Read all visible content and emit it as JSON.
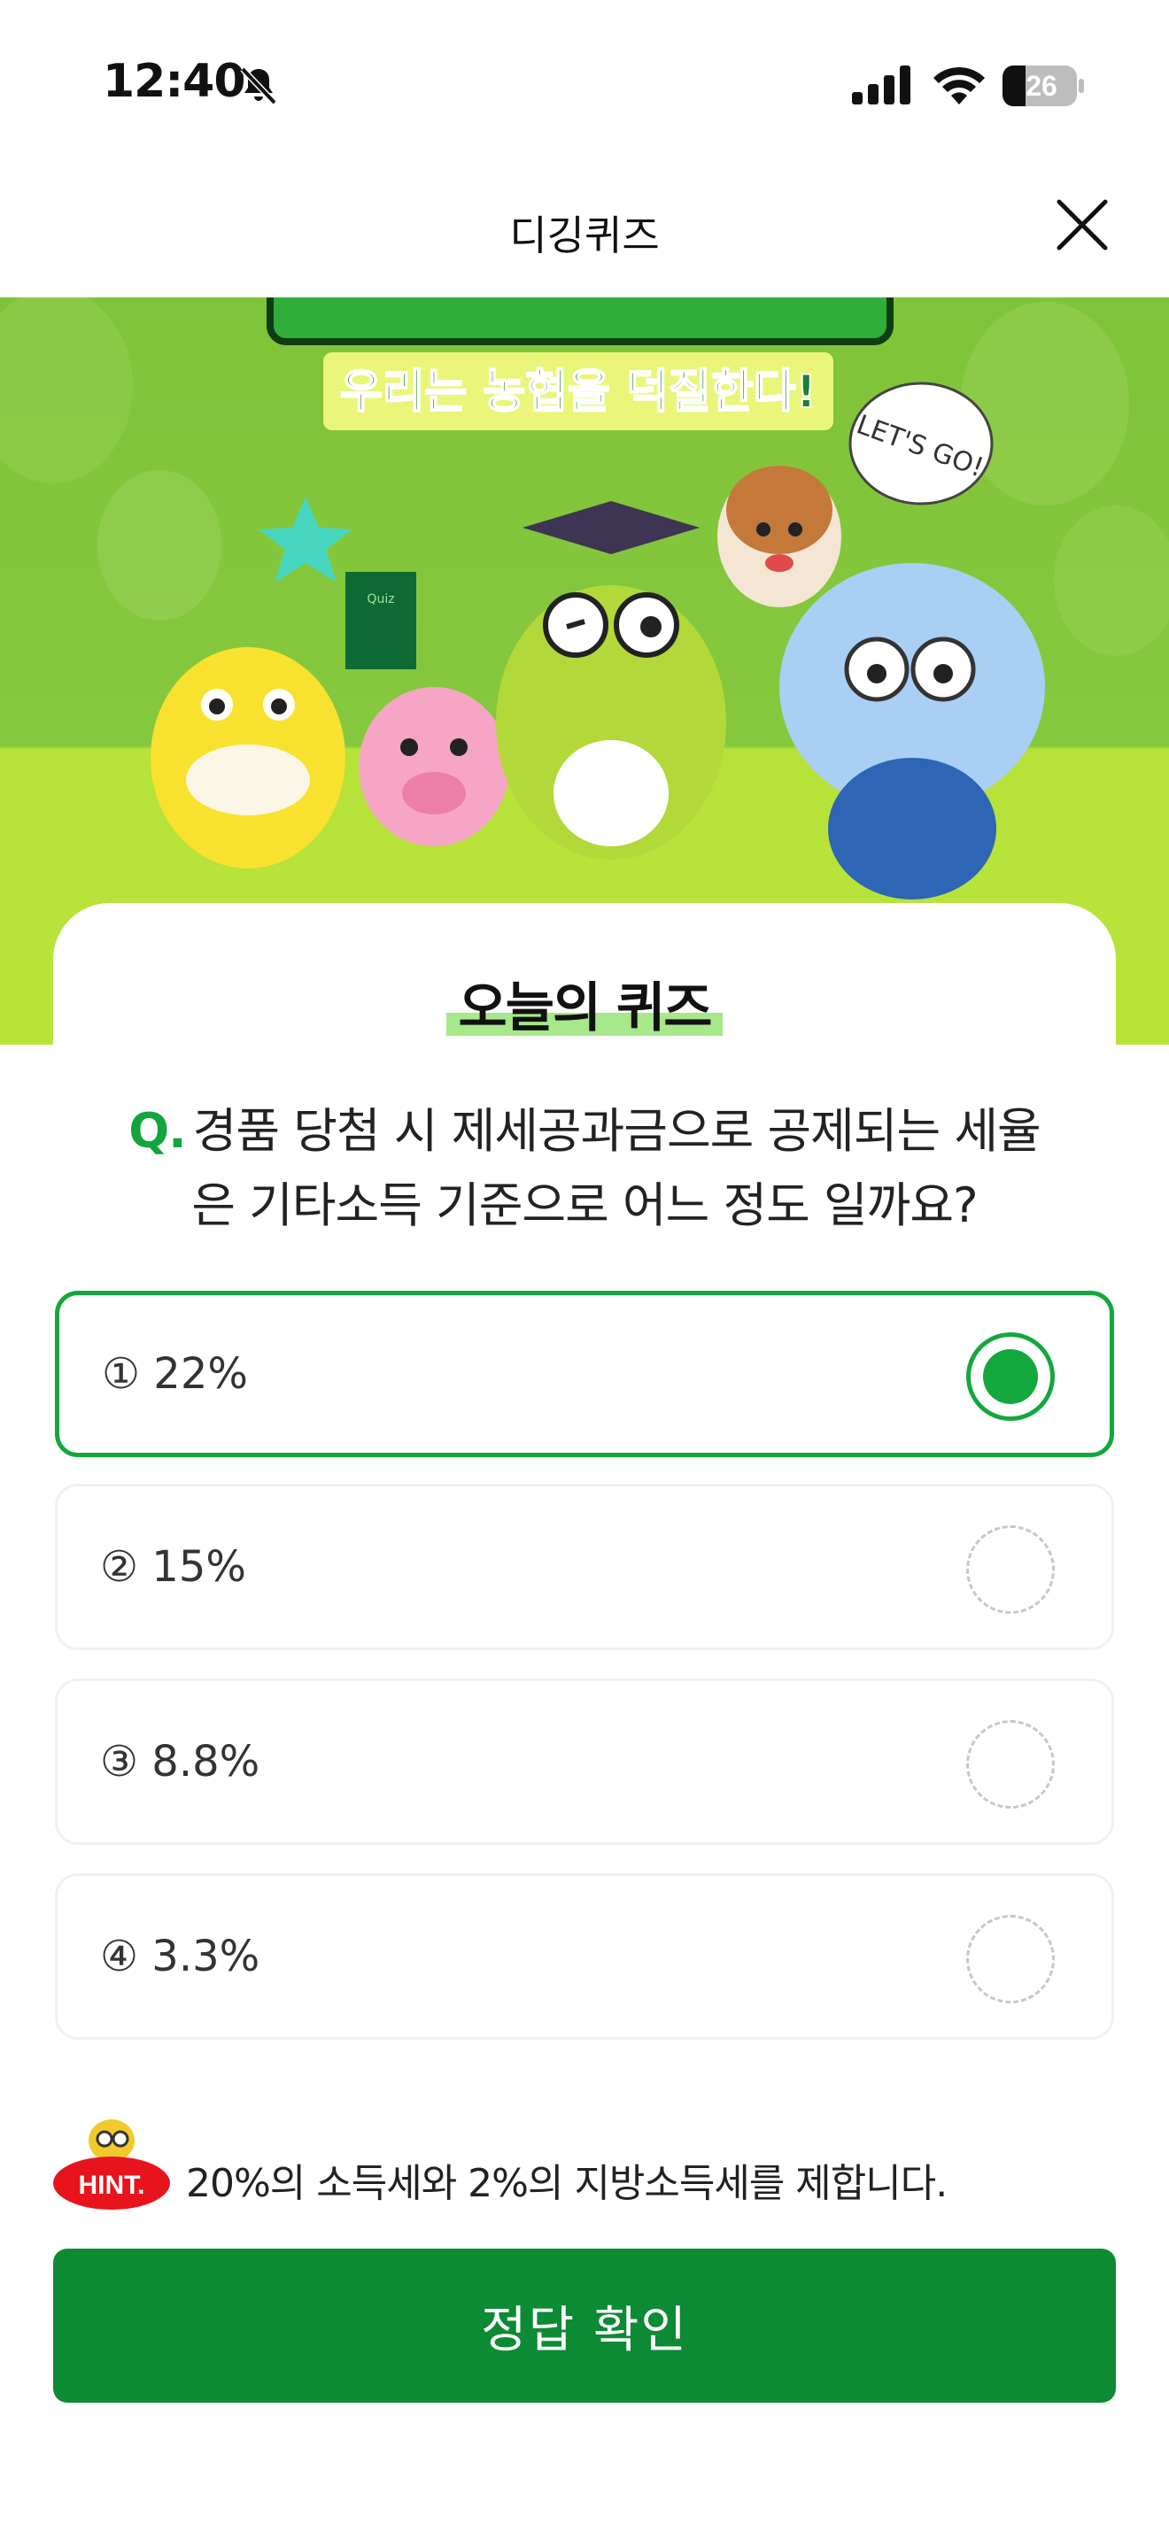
{
  "status_bar": {
    "time": "12:40",
    "battery": "26"
  },
  "header": {
    "title": "디깅퀴즈"
  },
  "banner": {
    "slogan": "우리는 농협을 덕질한다!",
    "bubble": "LET'S GO!",
    "book_label": "Quiz"
  },
  "quiz": {
    "title": "오늘의 퀴즈",
    "question_mark": "Q.",
    "question_line1": "경품 당첨 시 제세공과금으로 공제되는 세율",
    "question_line2": "은 기타소득 기준으로 어느 정도 일까요?",
    "options": [
      {
        "label": "① 22%",
        "selected": true
      },
      {
        "label": "② 15%",
        "selected": false
      },
      {
        "label": "③ 8.8%",
        "selected": false
      },
      {
        "label": "④ 3.3%",
        "selected": false
      }
    ]
  },
  "hint": {
    "badge": "HINT.",
    "text": "20%의 소득세와 2%의 지방소득세를 제합니다."
  },
  "submit": {
    "label": "정답 확인"
  },
  "colors": {
    "accent": "#13a83e",
    "button": "#0c8a34",
    "banner_green": "#7fc33a",
    "banner_lime": "#b8e43a",
    "hint_red": "#e8141d"
  }
}
